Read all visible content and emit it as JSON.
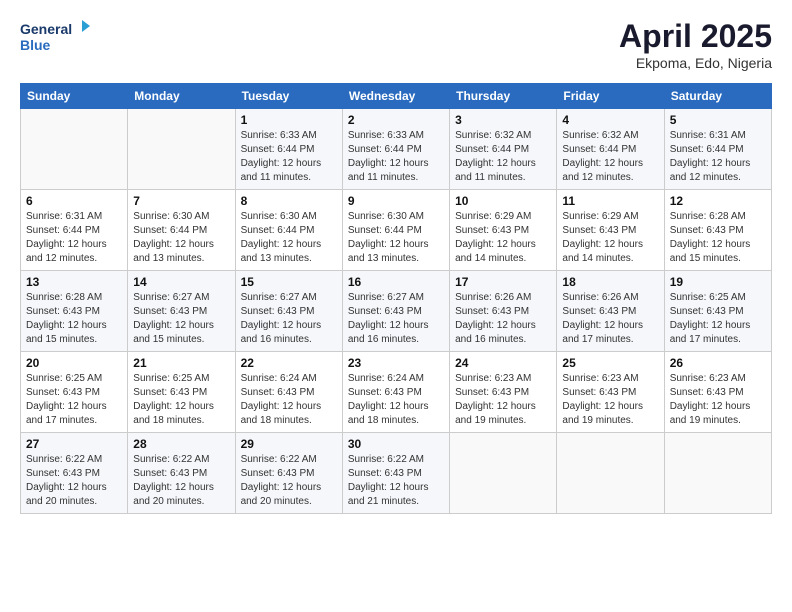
{
  "header": {
    "logo_line1": "General",
    "logo_line2": "Blue",
    "title": "April 2025",
    "subtitle": "Ekpoma, Edo, Nigeria"
  },
  "calendar": {
    "weekdays": [
      "Sunday",
      "Monday",
      "Tuesday",
      "Wednesday",
      "Thursday",
      "Friday",
      "Saturday"
    ],
    "rows": [
      [
        {
          "day": "",
          "info": ""
        },
        {
          "day": "",
          "info": ""
        },
        {
          "day": "1",
          "info": "Sunrise: 6:33 AM\nSunset: 6:44 PM\nDaylight: 12 hours and 11 minutes."
        },
        {
          "day": "2",
          "info": "Sunrise: 6:33 AM\nSunset: 6:44 PM\nDaylight: 12 hours and 11 minutes."
        },
        {
          "day": "3",
          "info": "Sunrise: 6:32 AM\nSunset: 6:44 PM\nDaylight: 12 hours and 11 minutes."
        },
        {
          "day": "4",
          "info": "Sunrise: 6:32 AM\nSunset: 6:44 PM\nDaylight: 12 hours and 12 minutes."
        },
        {
          "day": "5",
          "info": "Sunrise: 6:31 AM\nSunset: 6:44 PM\nDaylight: 12 hours and 12 minutes."
        }
      ],
      [
        {
          "day": "6",
          "info": "Sunrise: 6:31 AM\nSunset: 6:44 PM\nDaylight: 12 hours and 12 minutes."
        },
        {
          "day": "7",
          "info": "Sunrise: 6:30 AM\nSunset: 6:44 PM\nDaylight: 12 hours and 13 minutes."
        },
        {
          "day": "8",
          "info": "Sunrise: 6:30 AM\nSunset: 6:44 PM\nDaylight: 12 hours and 13 minutes."
        },
        {
          "day": "9",
          "info": "Sunrise: 6:30 AM\nSunset: 6:44 PM\nDaylight: 12 hours and 13 minutes."
        },
        {
          "day": "10",
          "info": "Sunrise: 6:29 AM\nSunset: 6:43 PM\nDaylight: 12 hours and 14 minutes."
        },
        {
          "day": "11",
          "info": "Sunrise: 6:29 AM\nSunset: 6:43 PM\nDaylight: 12 hours and 14 minutes."
        },
        {
          "day": "12",
          "info": "Sunrise: 6:28 AM\nSunset: 6:43 PM\nDaylight: 12 hours and 15 minutes."
        }
      ],
      [
        {
          "day": "13",
          "info": "Sunrise: 6:28 AM\nSunset: 6:43 PM\nDaylight: 12 hours and 15 minutes."
        },
        {
          "day": "14",
          "info": "Sunrise: 6:27 AM\nSunset: 6:43 PM\nDaylight: 12 hours and 15 minutes."
        },
        {
          "day": "15",
          "info": "Sunrise: 6:27 AM\nSunset: 6:43 PM\nDaylight: 12 hours and 16 minutes."
        },
        {
          "day": "16",
          "info": "Sunrise: 6:27 AM\nSunset: 6:43 PM\nDaylight: 12 hours and 16 minutes."
        },
        {
          "day": "17",
          "info": "Sunrise: 6:26 AM\nSunset: 6:43 PM\nDaylight: 12 hours and 16 minutes."
        },
        {
          "day": "18",
          "info": "Sunrise: 6:26 AM\nSunset: 6:43 PM\nDaylight: 12 hours and 17 minutes."
        },
        {
          "day": "19",
          "info": "Sunrise: 6:25 AM\nSunset: 6:43 PM\nDaylight: 12 hours and 17 minutes."
        }
      ],
      [
        {
          "day": "20",
          "info": "Sunrise: 6:25 AM\nSunset: 6:43 PM\nDaylight: 12 hours and 17 minutes."
        },
        {
          "day": "21",
          "info": "Sunrise: 6:25 AM\nSunset: 6:43 PM\nDaylight: 12 hours and 18 minutes."
        },
        {
          "day": "22",
          "info": "Sunrise: 6:24 AM\nSunset: 6:43 PM\nDaylight: 12 hours and 18 minutes."
        },
        {
          "day": "23",
          "info": "Sunrise: 6:24 AM\nSunset: 6:43 PM\nDaylight: 12 hours and 18 minutes."
        },
        {
          "day": "24",
          "info": "Sunrise: 6:23 AM\nSunset: 6:43 PM\nDaylight: 12 hours and 19 minutes."
        },
        {
          "day": "25",
          "info": "Sunrise: 6:23 AM\nSunset: 6:43 PM\nDaylight: 12 hours and 19 minutes."
        },
        {
          "day": "26",
          "info": "Sunrise: 6:23 AM\nSunset: 6:43 PM\nDaylight: 12 hours and 19 minutes."
        }
      ],
      [
        {
          "day": "27",
          "info": "Sunrise: 6:22 AM\nSunset: 6:43 PM\nDaylight: 12 hours and 20 minutes."
        },
        {
          "day": "28",
          "info": "Sunrise: 6:22 AM\nSunset: 6:43 PM\nDaylight: 12 hours and 20 minutes."
        },
        {
          "day": "29",
          "info": "Sunrise: 6:22 AM\nSunset: 6:43 PM\nDaylight: 12 hours and 20 minutes."
        },
        {
          "day": "30",
          "info": "Sunrise: 6:22 AM\nSunset: 6:43 PM\nDaylight: 12 hours and 21 minutes."
        },
        {
          "day": "",
          "info": ""
        },
        {
          "day": "",
          "info": ""
        },
        {
          "day": "",
          "info": ""
        }
      ]
    ]
  }
}
